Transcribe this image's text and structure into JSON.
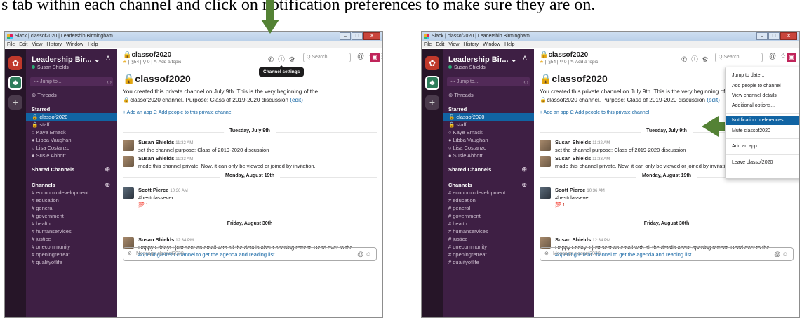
{
  "caption": "s tab within each channel and click on notification preferences to make sure they are on.",
  "colors": {
    "sidebar": "#3e1f44",
    "rail": "#261528",
    "selected": "#1164a3",
    "arrow": "#548235",
    "link": "#1264a3"
  },
  "window": {
    "title": "Slack | classof2020 | Leadership Birmingham",
    "menu": [
      "File",
      "Edit",
      "View",
      "History",
      "Window",
      "Help"
    ],
    "controls": [
      "–",
      "□",
      "✕"
    ]
  },
  "rail": {
    "ws1_glyph": "✿",
    "ws2_glyph": "♣",
    "add": "+"
  },
  "sidebar": {
    "workspace": "Leadership Bir...",
    "chevron": "⌄",
    "bell": "Δ",
    "user": "Susan Shields",
    "jump": "⊶ Jump to...",
    "jump_nav": "‹ ›",
    "threads": "⊚ Threads",
    "starred_header": "Starred",
    "starred": [
      "🔒 classof2020",
      "🔒 staff",
      "○ Kaye Emack",
      "● Libba Vaughan",
      "○ Lisa Costanzo",
      "● Susie Abbott"
    ],
    "shared_header": "Shared Channels",
    "channels_header": "Channels",
    "plus": "⊕",
    "channels": [
      "# economicdevelopment",
      "# education",
      "# general",
      "# government",
      "# health",
      "# humanservices",
      "# justice",
      "# onecommunity",
      "# openingretreat",
      "# qualityoflife"
    ]
  },
  "header": {
    "channel": "🔒classof2020",
    "meta_star": "★",
    "meta": " |  §54 | ⚲ 0 | ✎ Add a topic",
    "phone": "✆",
    "info": "ⓘ",
    "gear": "⚙",
    "search": "Q Search",
    "at": "@",
    "star": "☆",
    "more": "⋮",
    "box": "▣"
  },
  "tooltip": "Channel settings",
  "intro": {
    "title": "🔒classof2020",
    "line1": "You created this private channel on July 9th. This is the very beginning of the",
    "line2": "🔒classof2020 channel. Purpose: Class of 2019-2020 discussion",
    "edit": "(edit)",
    "links": "+ Add an app    Ω Add people to this private channel"
  },
  "days": [
    "Tuesday, July 9th",
    "Monday, August 19th",
    "Friday, August 30th"
  ],
  "messages": [
    {
      "who": "Susan Shields",
      "time": "11:32 AM",
      "text": "set the channel purpose: Class of 2019-2020 discussion"
    },
    {
      "who": "Susan Shields",
      "time": "11:33 AM",
      "text": "made this channel private. Now, it can only be viewed or joined by invitation."
    },
    {
      "who": "Scott Pierce",
      "time": "10:36 AM",
      "text": "#bestclassever",
      "reaction": "💯 1"
    },
    {
      "who": "Susan Shields",
      "time": "12:34 PM",
      "text": "Happy Friday! I just sent an email with all the details about opening retreat. Head over to the",
      "text2": "#openingretreat channel to get the agenda and reading list."
    }
  ],
  "composer": {
    "placeholder": "Message classof2020",
    "clip": "⊘",
    "icons": "@ ☺"
  },
  "menu": {
    "items": [
      "Jump to date...",
      "Add people to channel",
      "View channel details",
      "Additional options...",
      "Notification preferences...",
      "Mute classof2020",
      "Add an app",
      "Leave classof2020"
    ]
  }
}
